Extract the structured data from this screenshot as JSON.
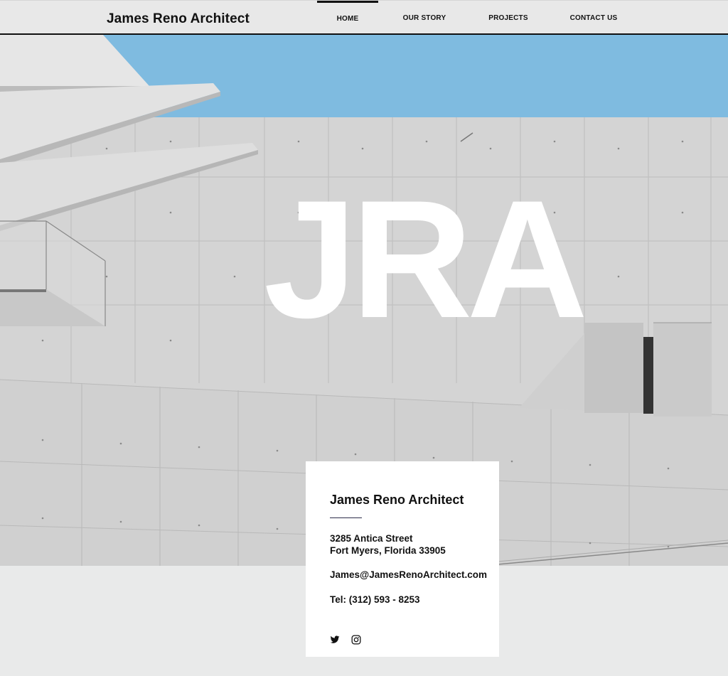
{
  "site": {
    "brand": "James Reno Architect"
  },
  "nav": {
    "items": [
      {
        "label": "HOME",
        "active": true
      },
      {
        "label": "OUR STORY",
        "active": false
      },
      {
        "label": "PROJECTS",
        "active": false
      },
      {
        "label": "CONTACT US",
        "active": false
      }
    ]
  },
  "hero": {
    "title": "JRA",
    "sky_color": "#7fbbe0",
    "concrete_color": "#d5d5d5"
  },
  "contact": {
    "title": "James Reno Architect",
    "address_line1": "3285 Antica Street",
    "address_line2": "Fort Myers, Florida 33905",
    "email": "James@JamesRenoArchitect.com",
    "phone": "Tel: (312) 593 - 8253"
  },
  "social": {
    "icons": [
      "twitter-icon",
      "instagram-icon"
    ]
  }
}
